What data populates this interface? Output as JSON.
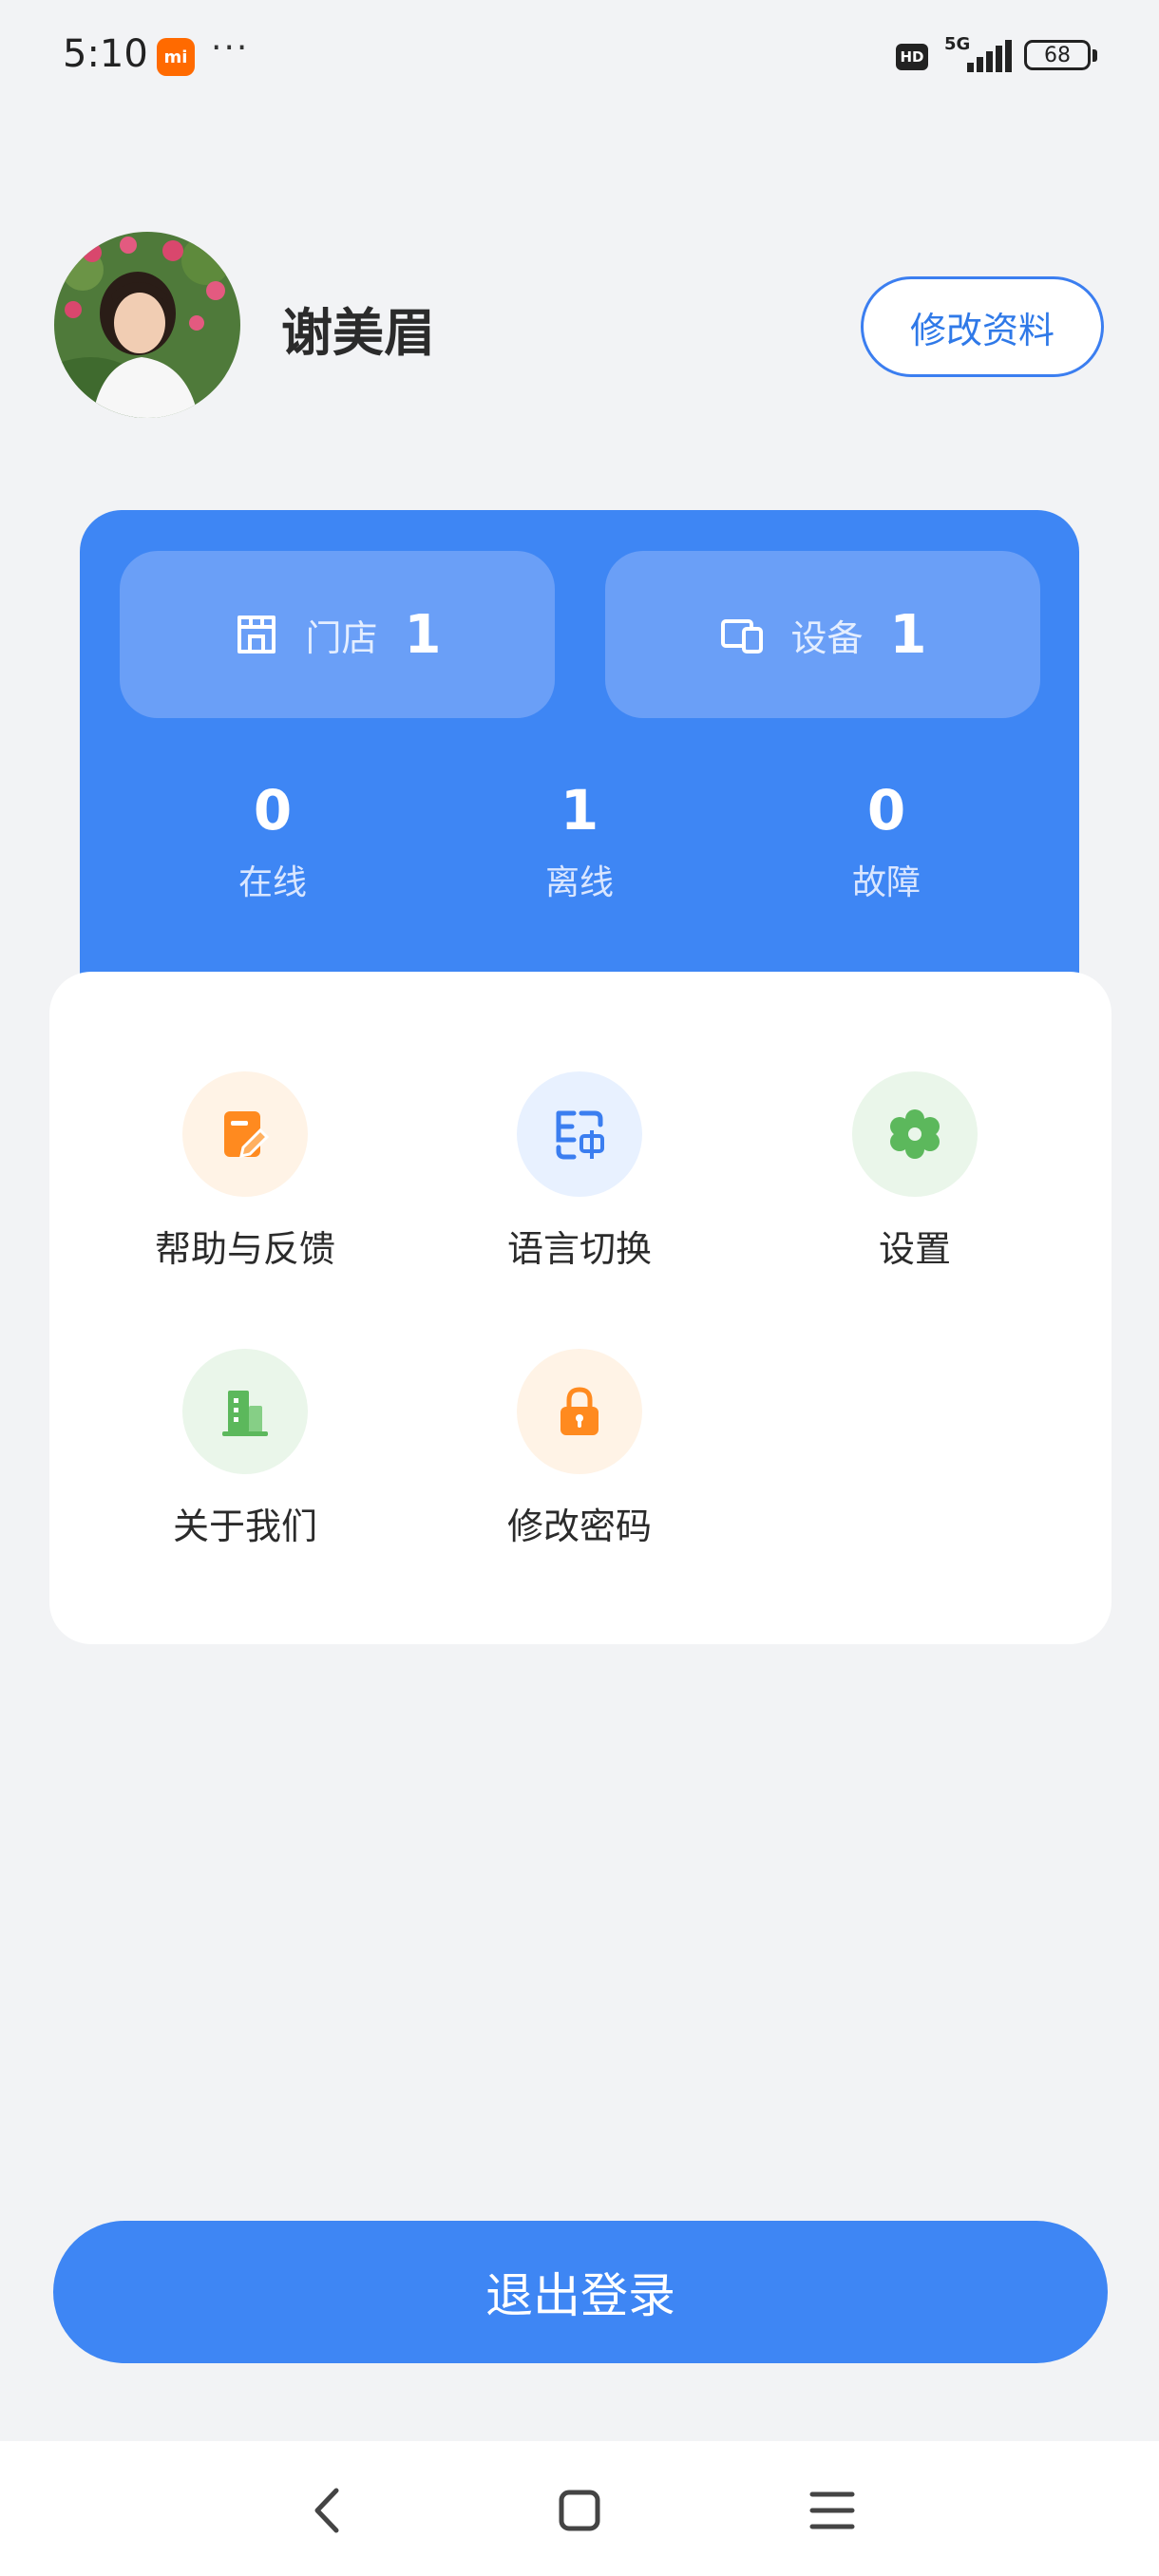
{
  "status_bar": {
    "time": "5:10",
    "brand_badge": "mi",
    "dots": "···",
    "hd_label": "HD",
    "network_label": "5G",
    "battery_level": "68",
    "signal_strength_bars": 4
  },
  "profile": {
    "name": "谢美眉",
    "edit_button_label": "修改资料"
  },
  "stats": {
    "stores": {
      "label": "门店",
      "count": "1",
      "icon": "store-icon"
    },
    "devices": {
      "label": "设备",
      "count": "1",
      "icon": "device-icon"
    },
    "status": [
      {
        "value": "0",
        "label": "在线"
      },
      {
        "value": "1",
        "label": "离线"
      },
      {
        "value": "0",
        "label": "故障"
      }
    ]
  },
  "menu": {
    "items": [
      {
        "label": "帮助与反馈",
        "icon": "feedback-edit-icon",
        "color": "#ff8a1f",
        "bg": "#fff3e6"
      },
      {
        "label": "语言切换",
        "icon": "language-switch-icon",
        "color": "#3b7ef0",
        "bg": "#e8f1ff"
      },
      {
        "label": "设置",
        "icon": "settings-gear-icon",
        "color": "#5cb85c",
        "bg": "#eaf6ea"
      },
      {
        "label": "关于我们",
        "icon": "building-icon",
        "color": "#5cb85c",
        "bg": "#eaf6ea"
      },
      {
        "label": "修改密码",
        "icon": "lock-icon",
        "color": "#ff8a1f",
        "bg": "#fff3e6"
      }
    ]
  },
  "logout": {
    "label": "退出登录"
  },
  "nav": {
    "back_icon": "back-chevron-icon",
    "home_icon": "home-square-icon",
    "menu_icon": "recent-apps-icon"
  },
  "colors": {
    "primary": "#3e86f4",
    "pill": "#6a9ff7",
    "background": "#f2f3f5",
    "text": "#2b2b2b"
  }
}
